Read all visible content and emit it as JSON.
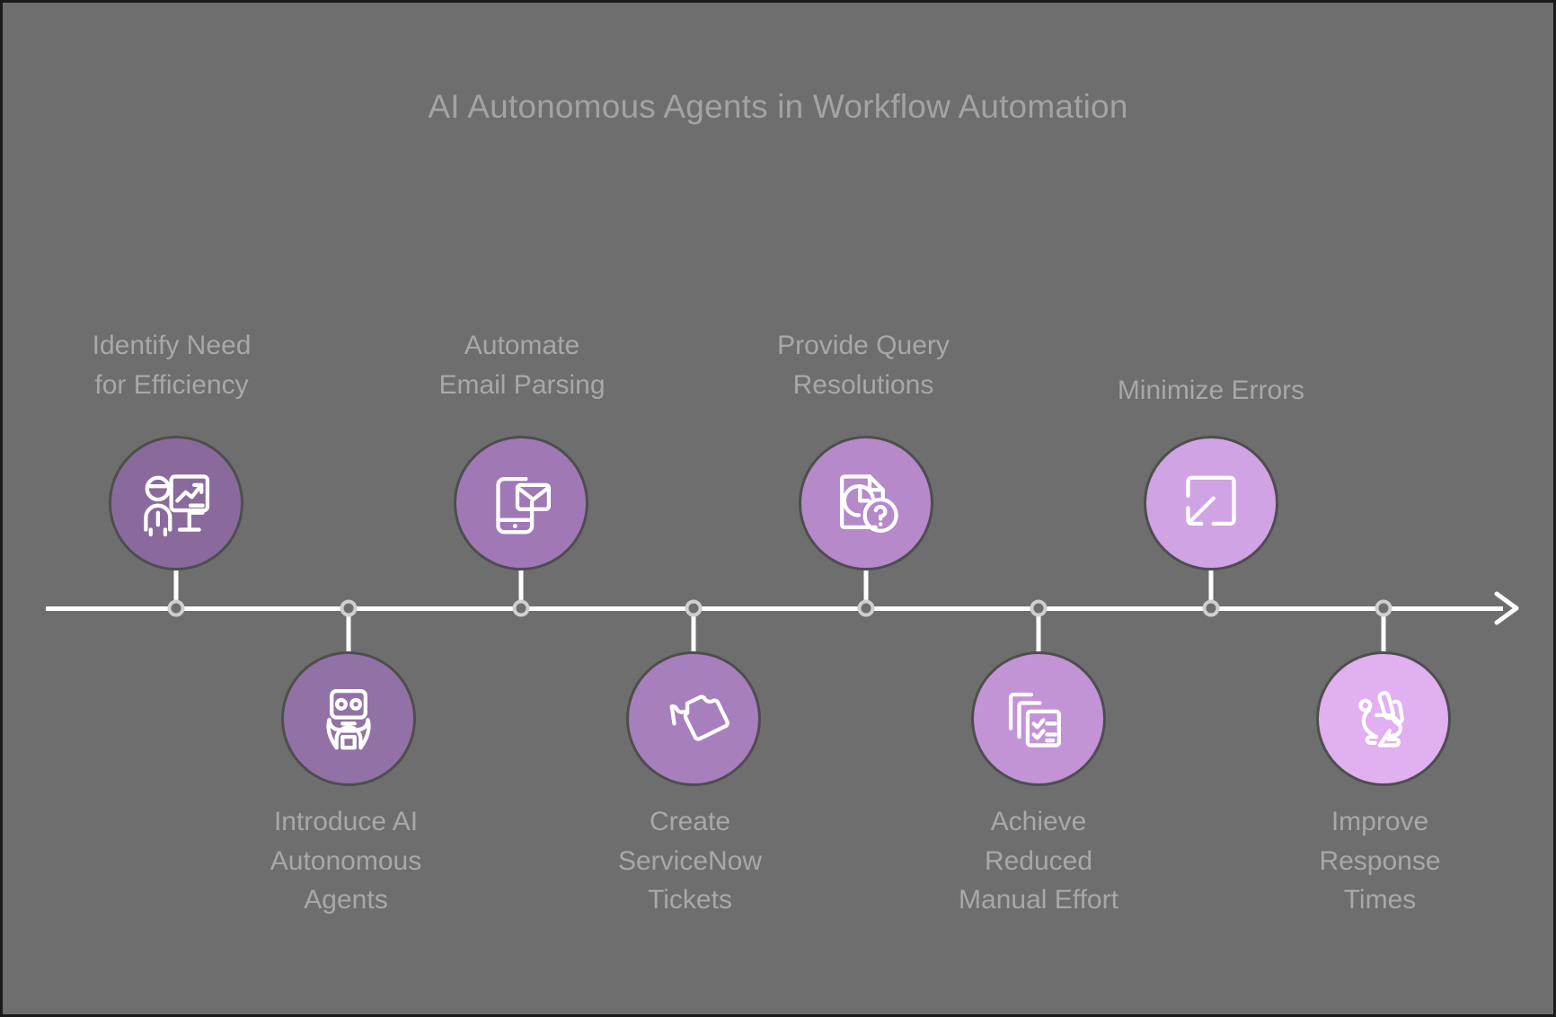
{
  "title": "AI Autonomous Agents in Workflow Automation",
  "colors": {
    "background": "#6e6e6e",
    "title_text": "#a3a3a3",
    "label_text": "#a8a8a8",
    "axis": "#ffffff",
    "tick_ring": "#cfcfcf",
    "node_border": "#4e4e4e",
    "icon_stroke": "#ffffff"
  },
  "timeline": {
    "arrow_direction": "right",
    "milestones": [
      {
        "label": "Identify Need\nfor Efficiency",
        "position": "above",
        "icon": "presentation-growth-chart-icon",
        "color": "#8a6a9c"
      },
      {
        "label": "Introduce AI\nAutonomous\nAgents",
        "position": "below",
        "icon": "robot-icon",
        "color": "#9272a6"
      },
      {
        "label": "Automate\nEmail Parsing",
        "position": "above",
        "icon": "mobile-email-icon",
        "color": "#a078b6"
      },
      {
        "label": "Create\nServiceNow\nTickets",
        "position": "below",
        "icon": "tickets-icon",
        "color": "#a87fbd"
      },
      {
        "label": "Provide Query\nResolutions",
        "position": "above",
        "icon": "document-clock-question-icon",
        "color": "#b689ca"
      },
      {
        "label": "Achieve\nReduced\nManual Effort",
        "position": "below",
        "icon": "stacked-checklist-icon",
        "color": "#c294d6"
      },
      {
        "label": "Minimize Errors",
        "position": "above",
        "icon": "minimize-arrow-icon",
        "color": "#d0a3e4"
      },
      {
        "label": "Improve\nResponse\nTimes",
        "position": "below",
        "icon": "rabbit-icon",
        "color": "#e0b0f0"
      }
    ]
  }
}
